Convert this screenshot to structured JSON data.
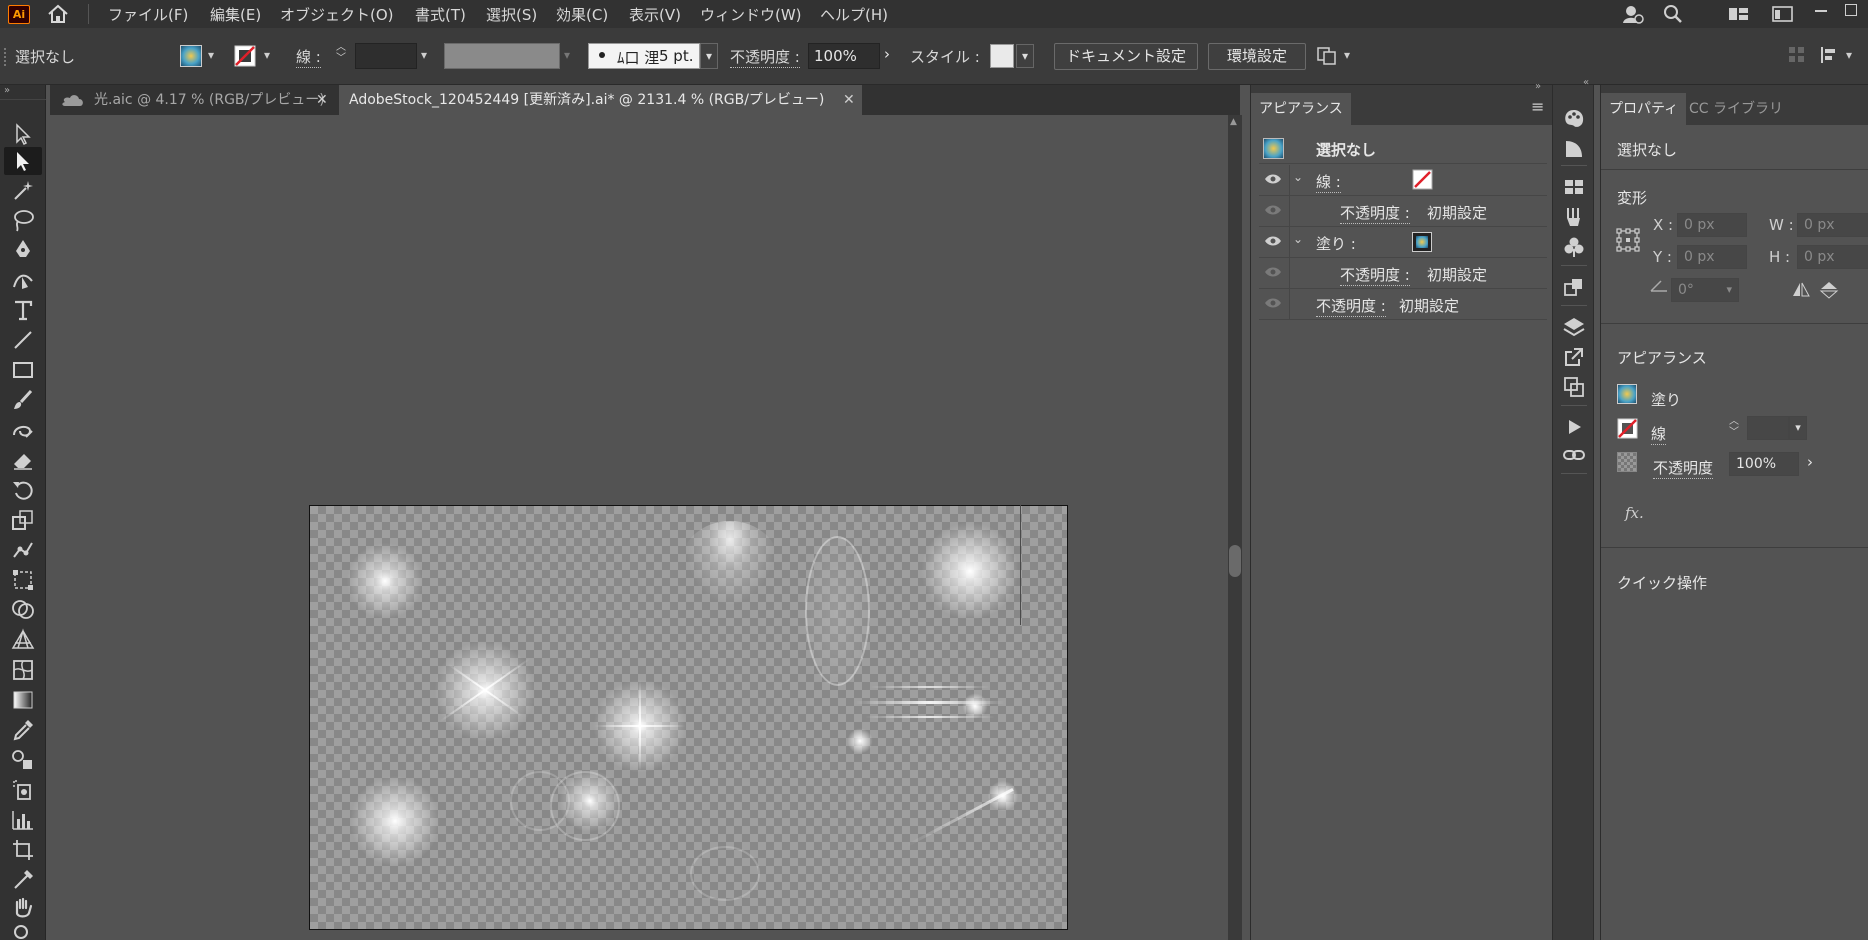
{
  "app": {
    "logo": "Ai"
  },
  "menu": [
    "ファイル(F)",
    "編集(E)",
    "オブジェクト(O)",
    "書式(T)",
    "選択(S)",
    "効果(C)",
    "表示(V)",
    "ウィンドウ(W)",
    "ヘルプ(H)"
  ],
  "control": {
    "selection": "選択なし",
    "stroke_label": "線 :",
    "brush": "5 pt.",
    "opacity_label": "不透明度 :",
    "opacity_value": "100%",
    "style_label": "スタイル :",
    "doc_settings": "ドキュメント設定",
    "prefs": "環境設定"
  },
  "tabs": [
    {
      "label": "光.aic @ 4.17 % (RGB/プレビュー)",
      "active": false
    },
    {
      "label": "AdobeStock_120452449 [更新済み].ai* @ 2131.4 % (RGB/プレビュー)",
      "active": true
    }
  ],
  "appearance": {
    "title": "アピアランス",
    "header": "選択なし",
    "rows": [
      {
        "label": "線 :",
        "kind": "stroke"
      },
      {
        "label": "不透明度 :",
        "value": "初期設定"
      },
      {
        "label": "塗り :",
        "kind": "fill"
      },
      {
        "label": "不透明度 :",
        "value": "初期設定"
      },
      {
        "label": "不透明度 :",
        "value": "初期設定"
      }
    ]
  },
  "properties": {
    "tab_active": "プロパティ",
    "tab_inactive": "CC ライブラリ",
    "selection": "選択なし",
    "transform": "変形",
    "x_label": "X :",
    "y_label": "Y :",
    "w_label": "W :",
    "h_label": "H :",
    "x_val": "0 px",
    "y_val": "0 px",
    "w_val": "0 px",
    "h_val": "0 px",
    "angle_val": "0°",
    "appearance": "アピアランス",
    "fill": "塗り",
    "stroke": "線",
    "opacity": "不透明度",
    "opacity_value": "100%",
    "fx": "fx.",
    "quick": "クイック操作"
  }
}
